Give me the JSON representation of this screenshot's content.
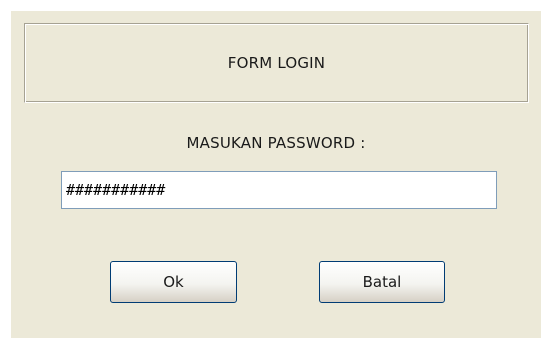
{
  "dialog": {
    "title": "FORM LOGIN",
    "prompt": "MASUKAN PASSWORD :",
    "password_value": "###########",
    "ok_label": "Ok",
    "cancel_label": "Batal"
  },
  "colors": {
    "dialog_background": "#ece9d8",
    "field_border": "#7f9db9",
    "button_border": "#003c74"
  }
}
